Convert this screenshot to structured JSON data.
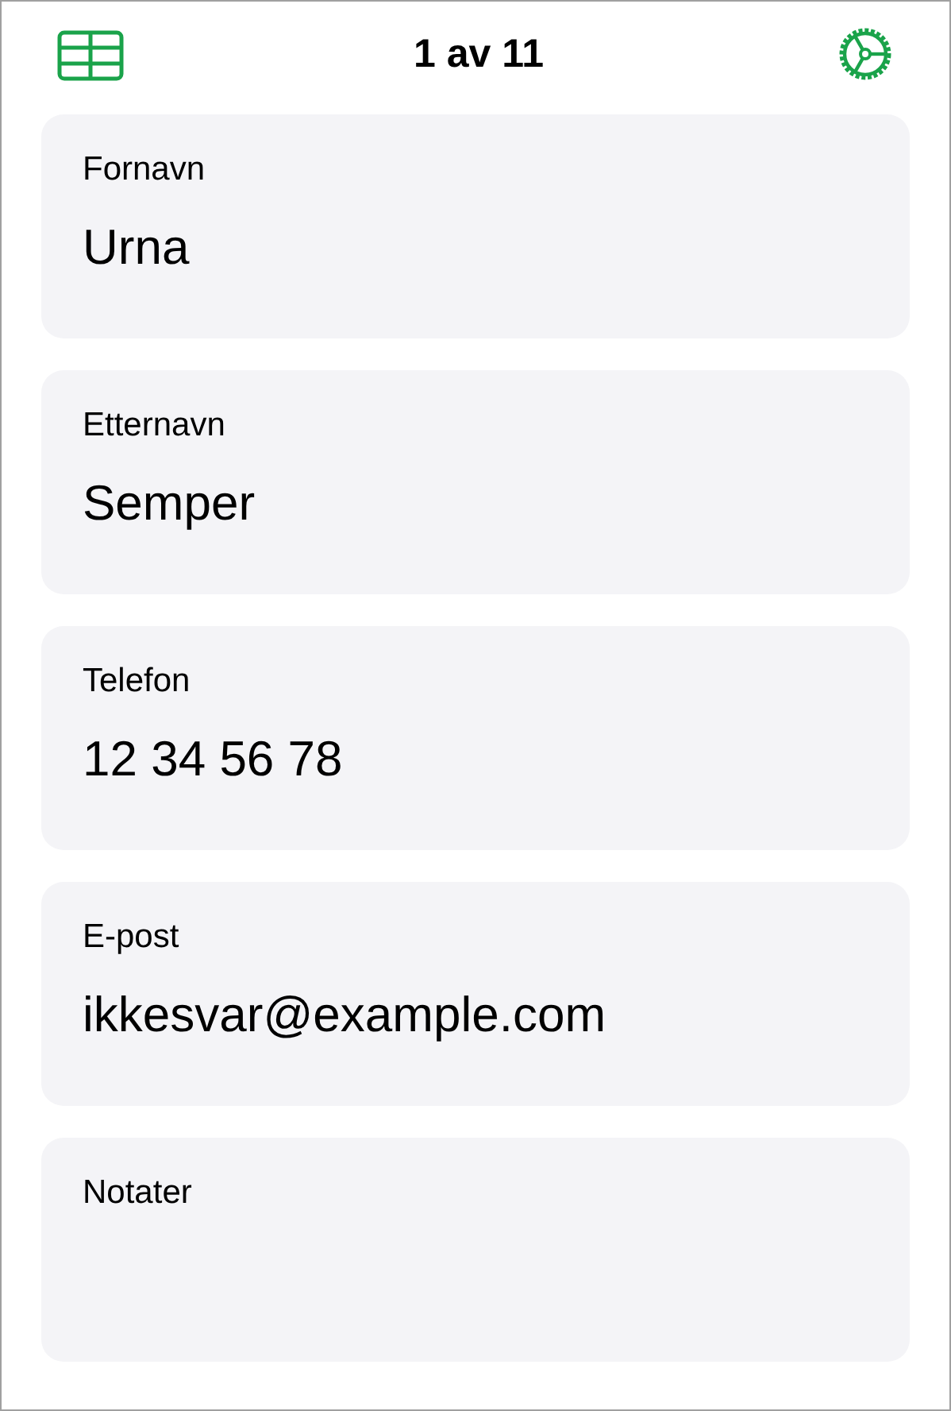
{
  "header": {
    "title": "1 av 11"
  },
  "fields": [
    {
      "label": "Fornavn",
      "value": "Urna"
    },
    {
      "label": "Etternavn",
      "value": "Semper"
    },
    {
      "label": "Telefon",
      "value": "12 34 56 78"
    },
    {
      "label": "E-post",
      "value": "ikkesvar@example.com"
    },
    {
      "label": "Notater"
    }
  ]
}
